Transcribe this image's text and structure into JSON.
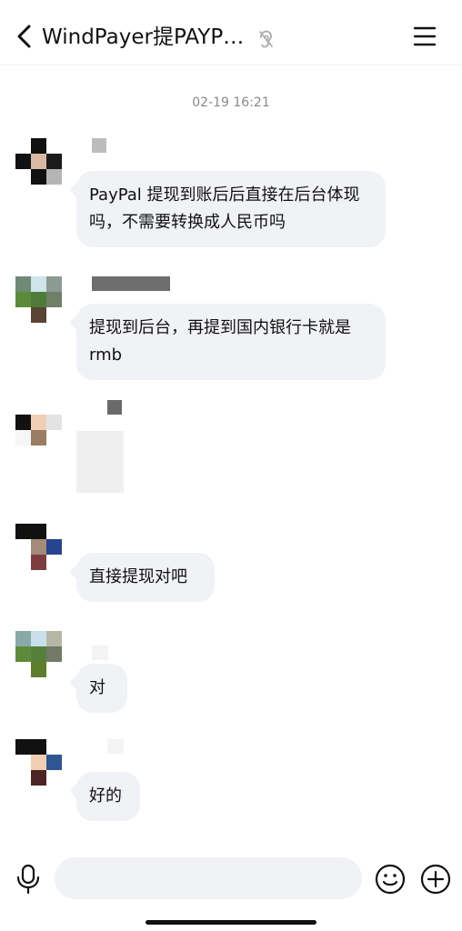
{
  "header": {
    "title": "WindPayer提PAYP…",
    "back_icon": "chevron-left-icon",
    "mute_icon": "ear-icon",
    "menu_icon": "hamburger-menu-icon"
  },
  "chat": {
    "timestamp": "02-19 16:21",
    "messages": [
      {
        "type": "text",
        "text": "PayPal 提现到账后后直接在后台体现吗，不需要转换成人民币吗"
      },
      {
        "type": "text",
        "text": "提现到后台，再提到国内银行卡就是rmb"
      },
      {
        "type": "image"
      },
      {
        "type": "text",
        "text": "直接提现对吧"
      },
      {
        "type": "text",
        "text": "对"
      },
      {
        "type": "text",
        "text": "好的"
      }
    ]
  },
  "input_bar": {
    "placeholder": "",
    "voice_icon": "microphone-icon",
    "emoji_icon": "smiley-icon",
    "more_icon": "plus-circle-icon"
  },
  "colors": {
    "bubble": "#f1f2f6",
    "text": "#111111",
    "timestamp": "#8a8a8a"
  }
}
